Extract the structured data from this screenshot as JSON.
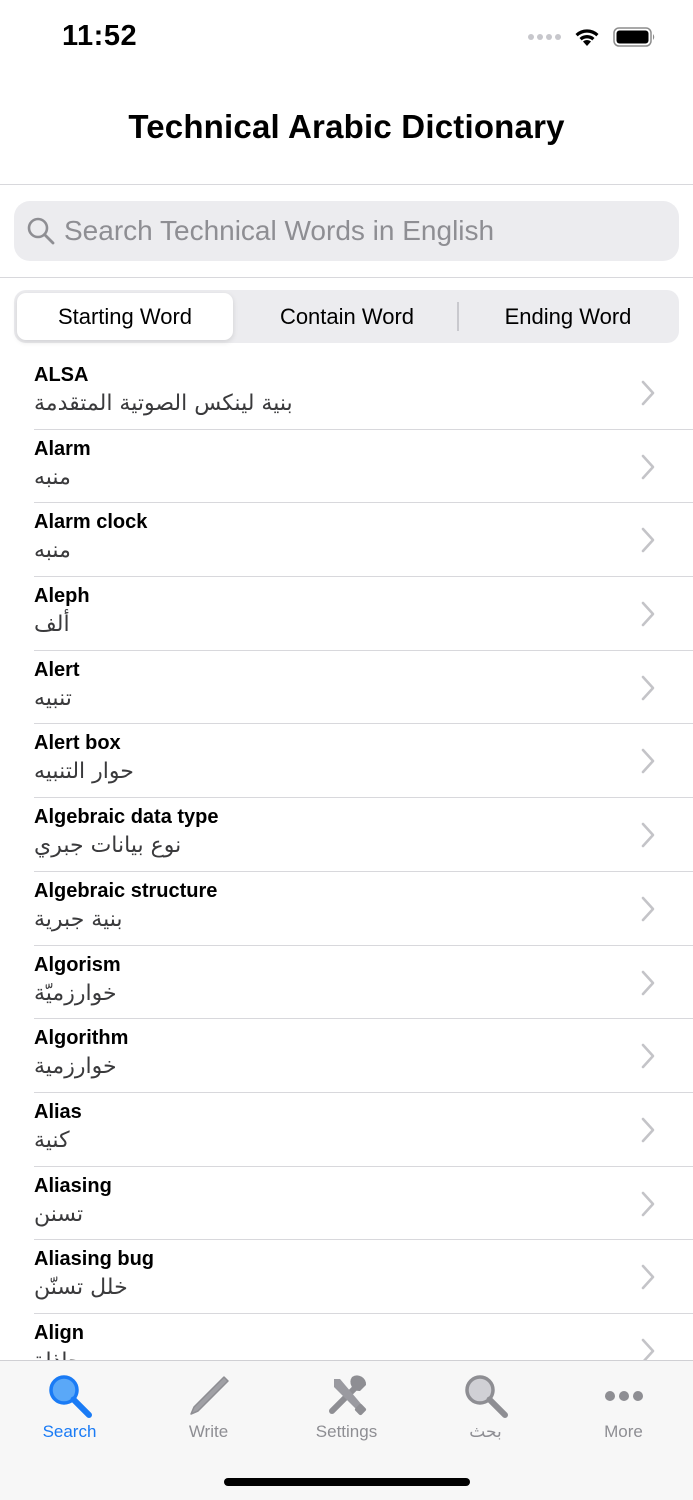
{
  "status": {
    "time": "11:52",
    "icons": [
      "signal-dots-icon",
      "wifi-icon",
      "battery-icon"
    ]
  },
  "nav": {
    "title": "Technical Arabic Dictionary"
  },
  "search": {
    "placeholder": "Search Technical Words in English",
    "value": ""
  },
  "segments": [
    {
      "label": "Starting Word",
      "selected": true
    },
    {
      "label": "Contain Word",
      "selected": false
    },
    {
      "label": "Ending Word",
      "selected": false
    }
  ],
  "words": [
    {
      "en": "ALSA",
      "ar": "بنية لينكس الصوتية المتقدمة"
    },
    {
      "en": "Alarm",
      "ar": "منبه"
    },
    {
      "en": "Alarm clock",
      "ar": "منبه"
    },
    {
      "en": "Aleph",
      "ar": "ألف"
    },
    {
      "en": "Alert",
      "ar": "تنبيه"
    },
    {
      "en": "Alert box",
      "ar": "حوار التنبيه"
    },
    {
      "en": "Algebraic data type",
      "ar": "نوع بيانات جبري"
    },
    {
      "en": "Algebraic structure",
      "ar": "بنية جبرية"
    },
    {
      "en": "Algorism",
      "ar": "خوارزميّة"
    },
    {
      "en": "Algorithm",
      "ar": "خوارزمية"
    },
    {
      "en": "Alias",
      "ar": "كنية"
    },
    {
      "en": "Aliasing",
      "ar": "تسنن"
    },
    {
      "en": "Aliasing bug",
      "ar": "خلل تسنّن"
    },
    {
      "en": "Align",
      "ar": "محاذاة"
    }
  ],
  "tabs": [
    {
      "label": "Search",
      "icon": "magnifier-icon",
      "active": true
    },
    {
      "label": "Write",
      "icon": "pencil-icon",
      "active": false
    },
    {
      "label": "Settings",
      "icon": "tools-icon",
      "active": false
    },
    {
      "label": "بحث",
      "icon": "magnifier-icon",
      "active": false
    },
    {
      "label": "More",
      "icon": "more-dots-icon",
      "active": false
    }
  ],
  "colors": {
    "accent": "#1a7bf5",
    "inactive": "#8e8e93",
    "separator": "#d8d8dc"
  }
}
